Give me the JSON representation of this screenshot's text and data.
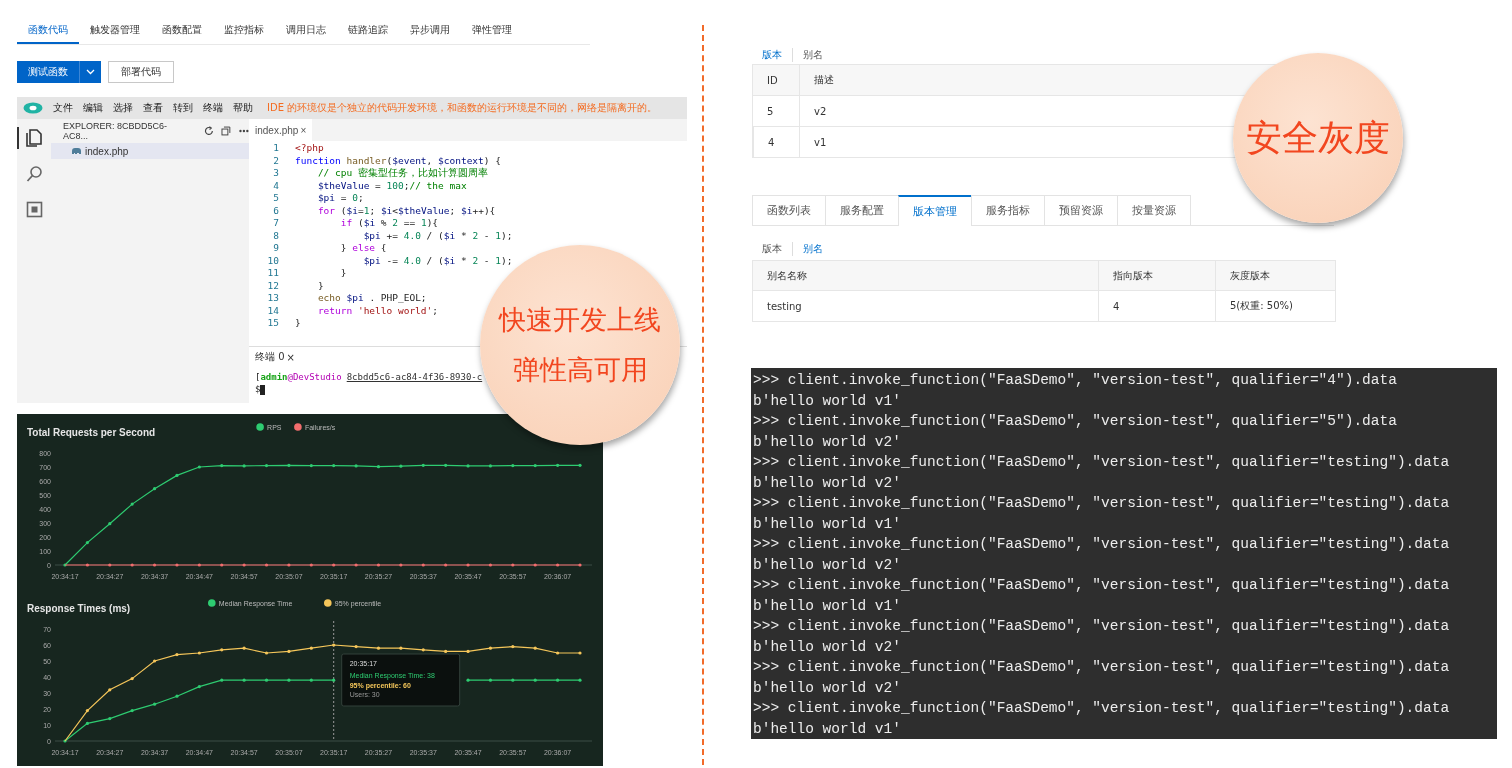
{
  "function_tabs": [
    {
      "label": "函数代码",
      "selected": true
    },
    {
      "label": "触发器管理",
      "selected": false
    },
    {
      "label": "函数配置",
      "selected": false
    },
    {
      "label": "监控指标",
      "selected": false
    },
    {
      "label": "调用日志",
      "selected": false
    },
    {
      "label": "链路追踪",
      "selected": false
    },
    {
      "label": "异步调用",
      "selected": false
    },
    {
      "label": "弹性管理",
      "selected": false
    }
  ],
  "actions": {
    "test_button": "测试函数",
    "deploy_button": "部署代码"
  },
  "ide": {
    "menu": [
      "文件",
      "编辑",
      "选择",
      "查看",
      "转到",
      "终端",
      "帮助"
    ],
    "notice": "IDE 的环境仅是个独立的代码开发环境，和函数的运行环境是不同的，网络是隔离开的。",
    "activity_bar": [
      {
        "kind": "files",
        "selected": true
      },
      {
        "kind": "search",
        "selected": false
      },
      {
        "kind": "extensions",
        "selected": false
      }
    ],
    "explorer": {
      "title": "EXPLORER: 8CBDD5C6-AC8...",
      "files": [
        {
          "name": "index.php",
          "selected": true
        }
      ]
    },
    "editor_tab": {
      "label": "index.php",
      "close": "×"
    },
    "code": [
      {
        "number": "1",
        "segments": [
          {
            "kind": "tag",
            "text": "<?php"
          }
        ]
      },
      {
        "number": "2",
        "segments": [
          {
            "kind": "decl",
            "text": "function"
          },
          {
            "kind": "fn",
            "text": " handler"
          },
          {
            "kind": "plain",
            "text": "("
          },
          {
            "kind": "var",
            "text": "$event"
          },
          {
            "kind": "plain",
            "text": ", "
          },
          {
            "kind": "var",
            "text": "$context"
          },
          {
            "kind": "plain",
            "text": ") {"
          }
        ]
      },
      {
        "number": "3",
        "segments": [
          {
            "kind": "cmt",
            "text": "    // cpu 密集型任务，比如计算圆周率"
          }
        ]
      },
      {
        "number": "4",
        "segments": [
          {
            "kind": "var",
            "text": "    $theValue"
          },
          {
            "kind": "plain",
            "text": " = "
          },
          {
            "kind": "num",
            "text": "100"
          },
          {
            "kind": "plain",
            "text": ";"
          },
          {
            "kind": "cmt",
            "text": "// the max"
          }
        ]
      },
      {
        "number": "5",
        "segments": [
          {
            "kind": "var",
            "text": "    $pi"
          },
          {
            "kind": "plain",
            "text": " = "
          },
          {
            "kind": "num",
            "text": "0"
          },
          {
            "kind": "plain",
            "text": ";"
          }
        ]
      },
      {
        "number": "6",
        "segments": [
          {
            "kind": "ctrl",
            "text": "    for"
          },
          {
            "kind": "plain",
            "text": " ("
          },
          {
            "kind": "var",
            "text": "$i"
          },
          {
            "kind": "plain",
            "text": "="
          },
          {
            "kind": "num",
            "text": "1"
          },
          {
            "kind": "plain",
            "text": "; "
          },
          {
            "kind": "var",
            "text": "$i"
          },
          {
            "kind": "plain",
            "text": "<"
          },
          {
            "kind": "var",
            "text": "$theValue"
          },
          {
            "kind": "plain",
            "text": "; "
          },
          {
            "kind": "var",
            "text": "$i"
          },
          {
            "kind": "plain",
            "text": "++){"
          }
        ]
      },
      {
        "number": "7",
        "segments": [
          {
            "kind": "ctrl",
            "text": "        if"
          },
          {
            "kind": "plain",
            "text": " ("
          },
          {
            "kind": "var",
            "text": "$i"
          },
          {
            "kind": "plain",
            "text": " % "
          },
          {
            "kind": "num",
            "text": "2"
          },
          {
            "kind": "plain",
            "text": " == "
          },
          {
            "kind": "num",
            "text": "1"
          },
          {
            "kind": "plain",
            "text": "){"
          }
        ]
      },
      {
        "number": "8",
        "segments": [
          {
            "kind": "var",
            "text": "            $pi"
          },
          {
            "kind": "plain",
            "text": " += "
          },
          {
            "kind": "num",
            "text": "4.0"
          },
          {
            "kind": "plain",
            "text": " / ("
          },
          {
            "kind": "var",
            "text": "$i"
          },
          {
            "kind": "plain",
            "text": " * "
          },
          {
            "kind": "num",
            "text": "2"
          },
          {
            "kind": "plain",
            "text": " - "
          },
          {
            "kind": "num",
            "text": "1"
          },
          {
            "kind": "plain",
            "text": ");"
          }
        ]
      },
      {
        "number": "9",
        "segments": [
          {
            "kind": "plain",
            "text": "        } "
          },
          {
            "kind": "ctrl",
            "text": "else"
          },
          {
            "kind": "plain",
            "text": " {"
          }
        ]
      },
      {
        "number": "10",
        "segments": [
          {
            "kind": "var",
            "text": "            $pi"
          },
          {
            "kind": "plain",
            "text": " -= "
          },
          {
            "kind": "num",
            "text": "4.0"
          },
          {
            "kind": "plain",
            "text": " / ("
          },
          {
            "kind": "var",
            "text": "$i"
          },
          {
            "kind": "plain",
            "text": " * "
          },
          {
            "kind": "num",
            "text": "2"
          },
          {
            "kind": "plain",
            "text": " - "
          },
          {
            "kind": "num",
            "text": "1"
          },
          {
            "kind": "plain",
            "text": ");"
          }
        ]
      },
      {
        "number": "11",
        "segments": [
          {
            "kind": "plain",
            "text": "        }"
          }
        ]
      },
      {
        "number": "12",
        "segments": [
          {
            "kind": "plain",
            "text": "    }"
          }
        ]
      },
      {
        "number": "13",
        "segments": [
          {
            "kind": "fn",
            "text": "    echo"
          },
          {
            "kind": "var",
            "text": " $pi"
          },
          {
            "kind": "plain",
            "text": " . PHP_EOL;"
          }
        ]
      },
      {
        "number": "14",
        "segments": [
          {
            "kind": "ctrl",
            "text": "    return"
          },
          {
            "kind": "str",
            "text": " 'hello world'"
          },
          {
            "kind": "plain",
            "text": ";"
          }
        ]
      },
      {
        "number": "15",
        "segments": [
          {
            "kind": "plain",
            "text": "}"
          }
        ]
      }
    ],
    "terminal": {
      "tab": {
        "label": "终端 0",
        "close": "×"
      },
      "lines": [
        {
          "cursor": false,
          "segments": [
            {
              "kind": "plain",
              "text": "["
            },
            {
              "kind": "user",
              "text": "admin"
            },
            {
              "kind": "host",
              "text": "@DevStudio"
            },
            {
              "kind": "path",
              "text": "8cbdd5c6-ac84-4f36-8930-c"
            }
          ]
        },
        {
          "cursor": true,
          "segments": [
            {
              "kind": "plain",
              "text": "$"
            }
          ]
        }
      ]
    }
  },
  "perf": {
    "charts": [
      {
        "chart_data": {
          "type": "line",
          "title": "Total Requests per Second",
          "legend": "top",
          "categories": [
            "20:34:17",
            null,
            "20:34:27",
            null,
            "20:34:37",
            null,
            "20:34:47",
            null,
            "20:34:57",
            null,
            "20:35:07",
            null,
            "20:35:17",
            null,
            "20:35:27",
            null,
            "20:35:37",
            null,
            "20:35:47",
            null,
            "20:35:57",
            null,
            "20:36:07",
            null
          ],
          "series": [
            {
              "name": "RPS",
              "color": "#2ecc71",
              "values": [
                0,
                160,
                295,
                435,
                545,
                640,
                700,
                710,
                708,
                710,
                712,
                710,
                710,
                708,
                702,
                706,
                712,
                712,
                708,
                708,
                710,
                710,
                712,
                712
              ]
            },
            {
              "name": "Failures/s",
              "color": "#f26d6d",
              "values": [
                0,
                0,
                0,
                0,
                0,
                0,
                0,
                0,
                0,
                0,
                0,
                0,
                0,
                0,
                0,
                0,
                0,
                0,
                0,
                0,
                0,
                0,
                0,
                0
              ]
            }
          ],
          "ylim": [
            0,
            800
          ],
          "yticks": [
            0,
            100,
            200,
            300,
            400,
            500,
            600,
            700,
            800
          ]
        }
      },
      {
        "chart_data": {
          "type": "line",
          "title": "Response Times (ms)",
          "legend": "top",
          "categories": [
            "20:34:17",
            null,
            "20:34:27",
            null,
            "20:34:37",
            null,
            "20:34:47",
            null,
            "20:34:57",
            null,
            "20:35:07",
            null,
            "20:35:17",
            null,
            "20:35:27",
            null,
            "20:35:37",
            null,
            "20:35:47",
            null,
            "20:35:57",
            null,
            "20:36:07",
            null
          ],
          "series": [
            {
              "name": "Median Response Time",
              "color": "#2ecc71",
              "values": [
                0,
                11,
                14,
                19,
                23,
                28,
                34,
                38,
                38,
                38,
                38,
                38,
                38,
                null,
                null,
                null,
                null,
                null,
                38,
                38,
                38,
                38,
                38,
                38
              ]
            },
            {
              "name": "95% percentile",
              "color": "#f5c65a",
              "values": [
                0,
                19,
                32,
                39,
                50,
                54,
                55,
                57,
                58,
                55,
                56,
                58,
                60,
                59,
                58,
                58,
                57,
                56,
                56,
                58,
                59,
                58,
                55,
                55
              ]
            }
          ],
          "ylim": [
            0,
            70
          ],
          "yticks": [
            0,
            10,
            20,
            30,
            40,
            50,
            60,
            70
          ]
        },
        "tooltip": {
          "title": "20:35:17",
          "lines": [
            {
              "kind": "median",
              "text": "Median Response Time: 38"
            },
            {
              "kind": "p95",
              "text": "95% percentile: 60"
            },
            {
              "kind": "users",
              "text": "Users: 30"
            }
          ]
        }
      }
    ]
  },
  "versions_panel": {
    "subtabs": [
      {
        "label": "版本",
        "selected": true
      },
      {
        "label": "别名",
        "selected": false
      }
    ],
    "columns": [
      "ID",
      "描述"
    ],
    "rows": [
      [
        "5",
        "v2"
      ],
      [
        "4",
        "v1"
      ]
    ]
  },
  "service_tabs": [
    {
      "label": "函数列表",
      "selected": false
    },
    {
      "label": "服务配置",
      "selected": false
    },
    {
      "label": "版本管理",
      "selected": true
    },
    {
      "label": "服务指标",
      "selected": false
    },
    {
      "label": "预留资源",
      "selected": false
    },
    {
      "label": "按量资源",
      "selected": false
    }
  ],
  "alias_panel": {
    "subtabs": [
      {
        "label": "版本",
        "selected": false
      },
      {
        "label": "别名",
        "selected": true
      }
    ],
    "columns": [
      "别名名称",
      "指向版本",
      "灰度版本"
    ],
    "rows": [
      [
        "testing",
        "4",
        "5(权重: 50%)"
      ]
    ]
  },
  "console": {
    "lines": [
      ">>> client.invoke_function(\"FaaSDemo\", \"version-test\", qualifier=\"4\").data",
      "b'hello world v1'",
      ">>> client.invoke_function(\"FaaSDemo\", \"version-test\", qualifier=\"5\").data",
      "b'hello world v2'",
      ">>> client.invoke_function(\"FaaSDemo\", \"version-test\", qualifier=\"testing\").data",
      "b'hello world v2'",
      ">>> client.invoke_function(\"FaaSDemo\", \"version-test\", qualifier=\"testing\").data",
      "b'hello world v1'",
      ">>> client.invoke_function(\"FaaSDemo\", \"version-test\", qualifier=\"testing\").data",
      "b'hello world v2'",
      ">>> client.invoke_function(\"FaaSDemo\", \"version-test\", qualifier=\"testing\").data",
      "b'hello world v1'",
      ">>> client.invoke_function(\"FaaSDemo\", \"version-test\", qualifier=\"testing\").data",
      "b'hello world v2'",
      ">>> client.invoke_function(\"FaaSDemo\", \"version-test\", qualifier=\"testing\").data",
      "b'hello world v2'",
      ">>> client.invoke_function(\"FaaSDemo\", \"version-test\", qualifier=\"testing\").data",
      "b'hello world v1'"
    ]
  },
  "callouts": [
    {
      "lines": [
        "快速开发上线",
        "弹性高可用"
      ]
    },
    {
      "lines": [
        "安全灰度"
      ]
    }
  ]
}
